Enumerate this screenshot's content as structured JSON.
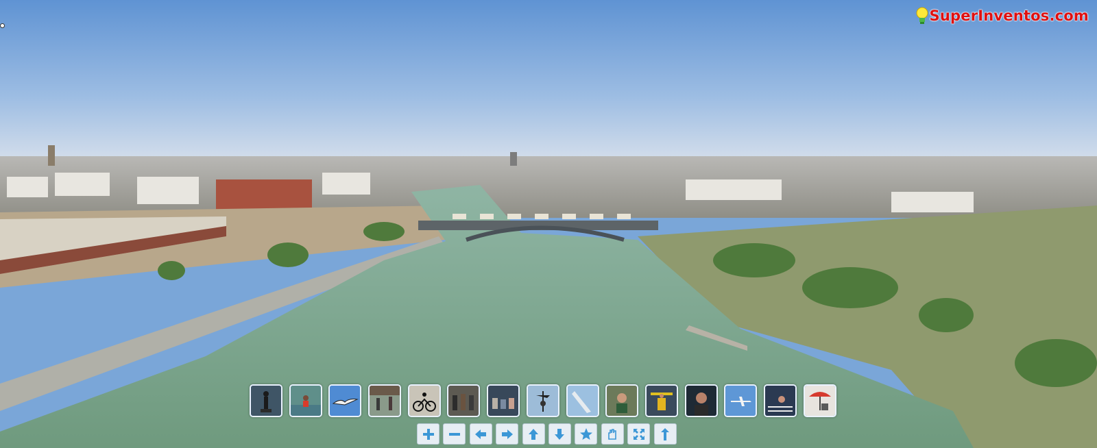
{
  "brand": {
    "logo_text": "SuperInventos.com",
    "logo_color": "#e01010",
    "icon": "lightbulb-icon"
  },
  "panorama": {
    "scene": "aerial view of a river with a bridge and city skyline",
    "sky_top": "#5f93d3",
    "sky_horizon": "#cfdced",
    "water": "#7fa88f"
  },
  "thumbnails": [
    {
      "id": "thumb-1",
      "icon": "person-statue-icon"
    },
    {
      "id": "thumb-2",
      "icon": "swimmer-icon"
    },
    {
      "id": "thumb-3",
      "icon": "seagull-icon"
    },
    {
      "id": "thumb-4",
      "icon": "people-walking-icon"
    },
    {
      "id": "thumb-5",
      "icon": "cyclist-icon"
    },
    {
      "id": "thumb-6",
      "icon": "people-group-icon"
    },
    {
      "id": "thumb-7",
      "icon": "people-bench-icon"
    },
    {
      "id": "thumb-8",
      "icon": "weathervane-icon"
    },
    {
      "id": "thumb-9",
      "icon": "tower-icon"
    },
    {
      "id": "thumb-10",
      "icon": "person-camera-icon"
    },
    {
      "id": "thumb-11",
      "icon": "worker-icon"
    },
    {
      "id": "thumb-12",
      "icon": "man-portrait-icon"
    },
    {
      "id": "thumb-13",
      "icon": "airplane-icon"
    },
    {
      "id": "thumb-14",
      "icon": "people-balcony-icon"
    },
    {
      "id": "thumb-15",
      "icon": "umbrella-icon"
    }
  ],
  "controls": [
    {
      "name": "zoom-in-button",
      "icon": "plus-icon"
    },
    {
      "name": "zoom-out-button",
      "icon": "minus-icon"
    },
    {
      "name": "pan-left-button",
      "icon": "arrow-left-icon"
    },
    {
      "name": "pan-right-button",
      "icon": "arrow-right-icon"
    },
    {
      "name": "pan-up-button",
      "icon": "arrow-up-icon"
    },
    {
      "name": "pan-down-button",
      "icon": "arrow-down-icon"
    },
    {
      "name": "favorite-button",
      "icon": "star-icon"
    },
    {
      "name": "hand-button",
      "icon": "hand-icon"
    },
    {
      "name": "fullscreen-button",
      "icon": "fullscreen-icon"
    },
    {
      "name": "info-button",
      "icon": "info-icon"
    }
  ],
  "ui_colors": {
    "control_bg": "#e7eef4",
    "control_icon": "#3c97d6",
    "thumb_border": "#eaf3ff"
  }
}
